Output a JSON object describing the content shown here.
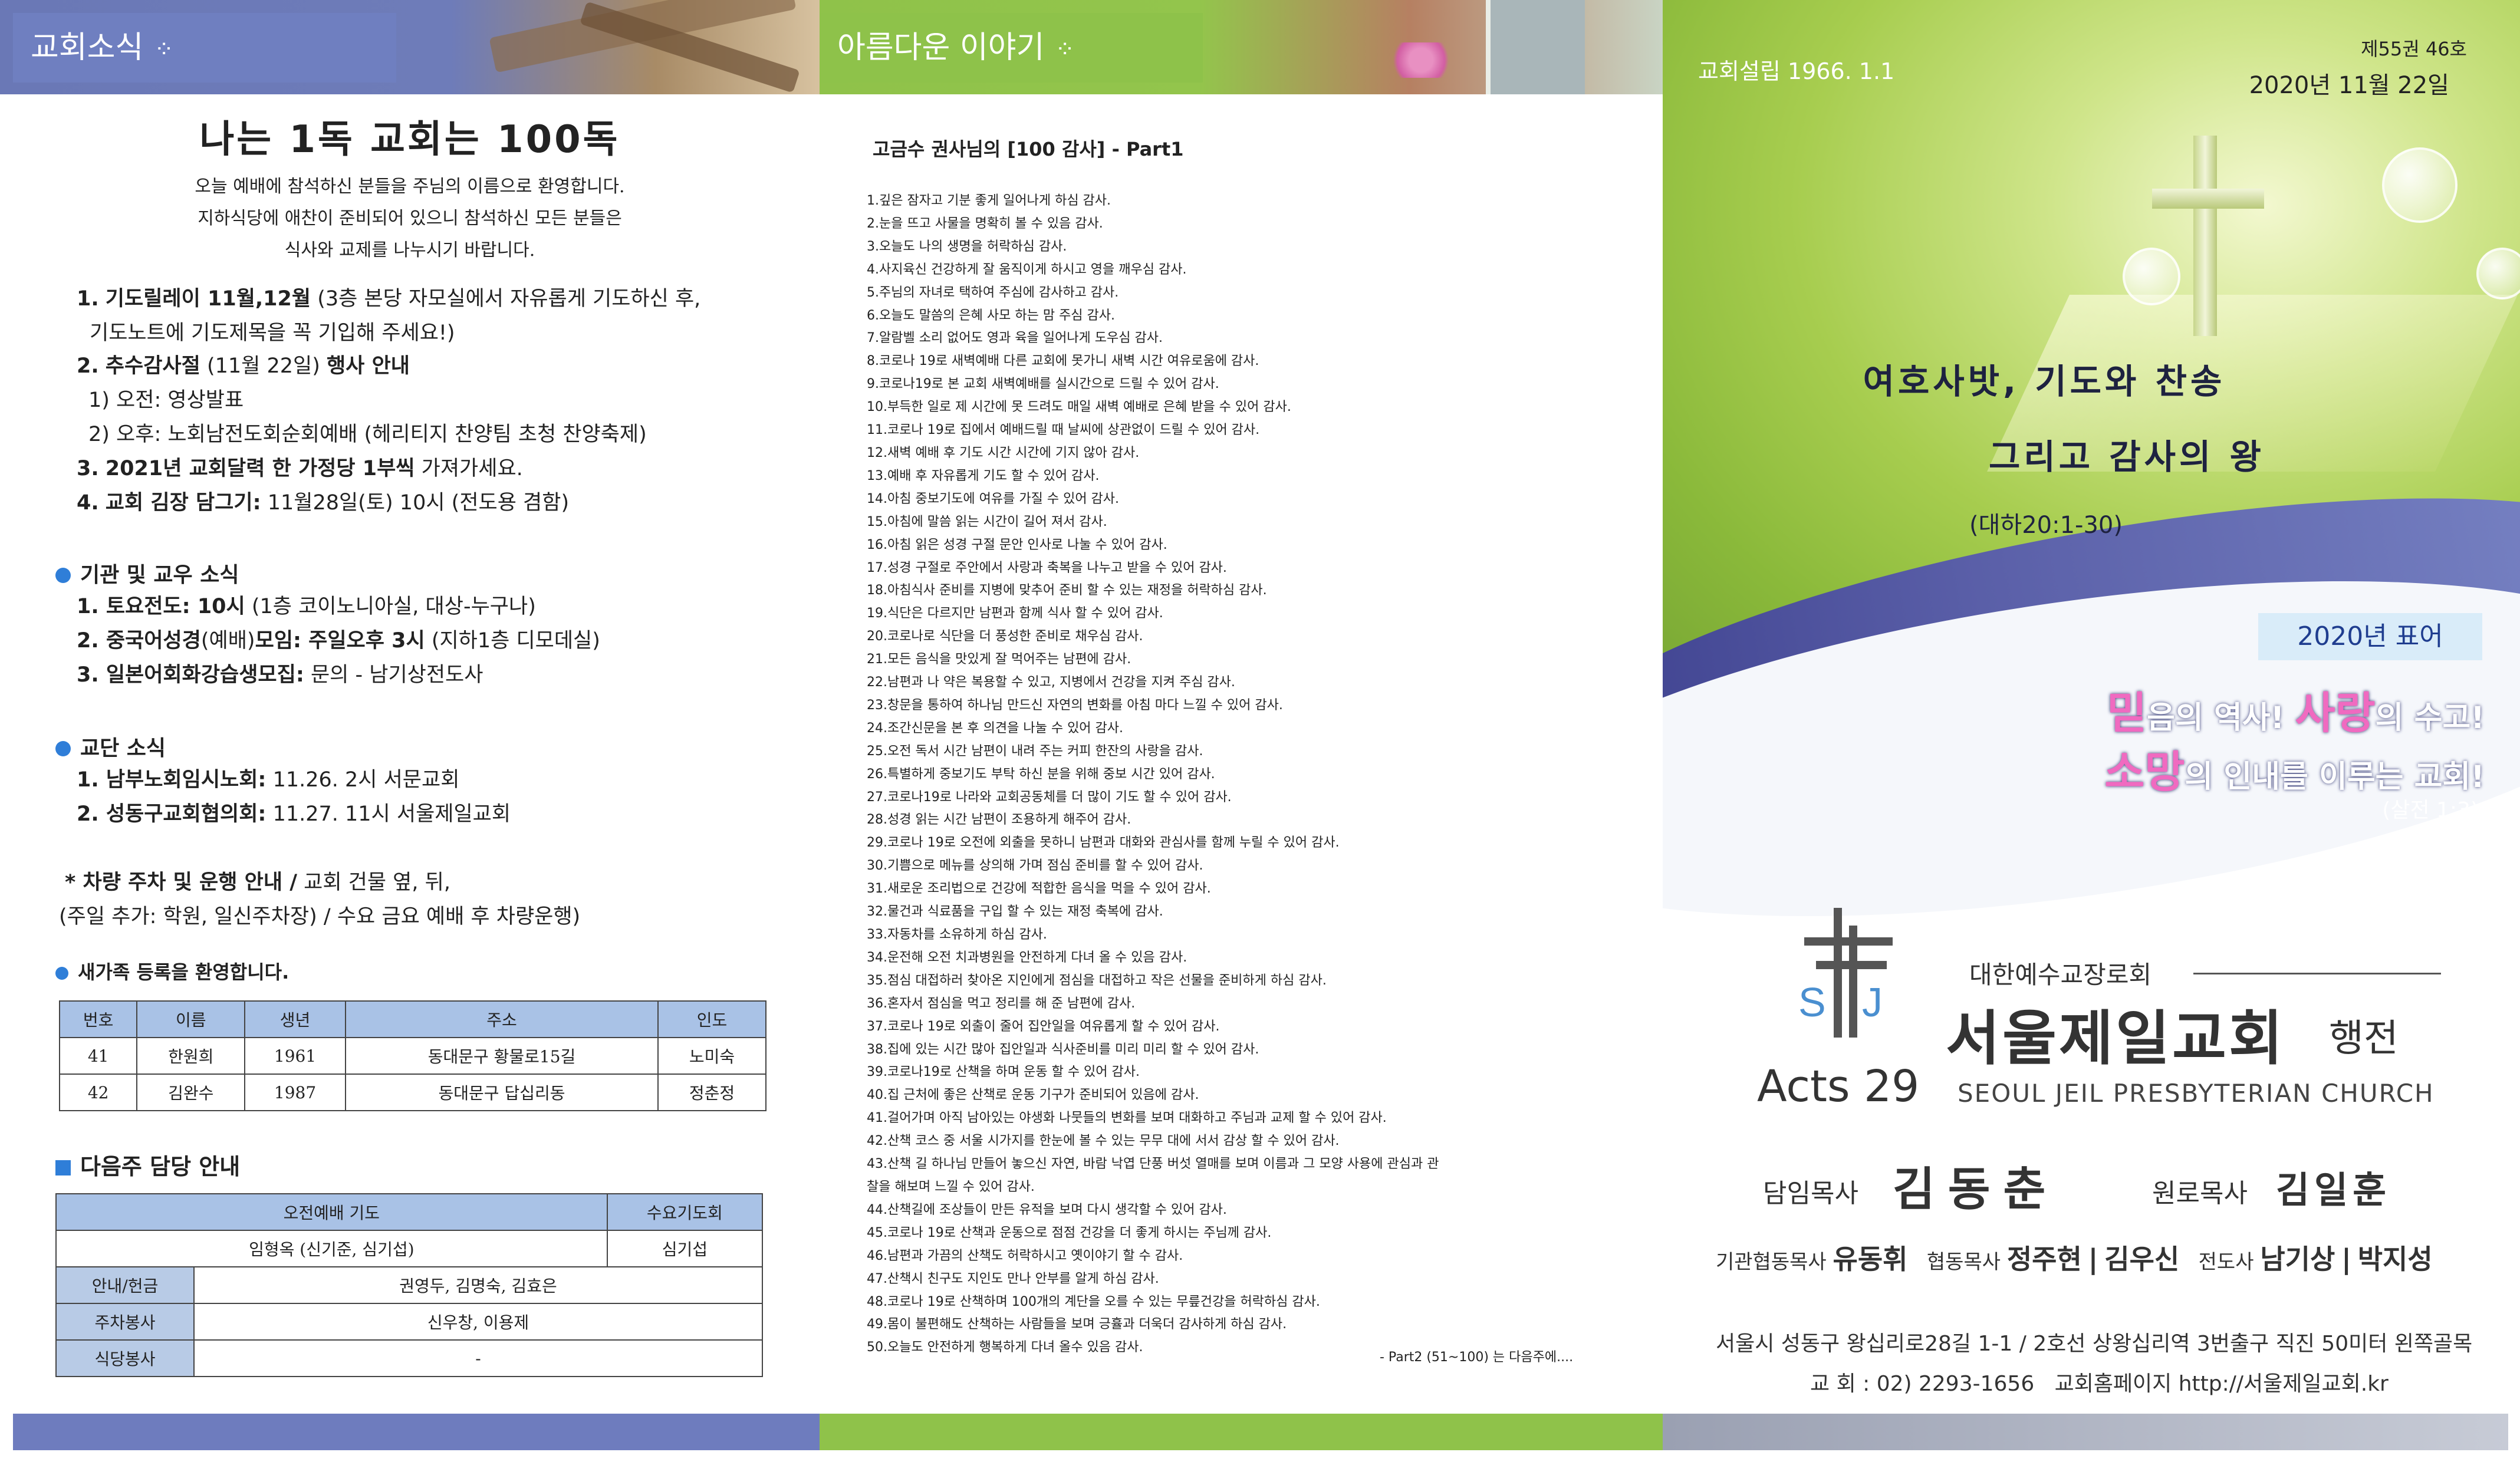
{
  "panel1": {
    "tab": "교회소식",
    "title": "나는 1독 교회는 100독",
    "welcome": [
      "오늘 예배에 참석하신 분들을 주님의 이름으로 환영합니다.",
      "지하식당에 애찬이 준비되어 있으니 참석하신 모든 분들은",
      "식사와 교제를 나누시기 바랍니다."
    ],
    "news": [
      {
        "num": "1.",
        "head": "기도릴레이 11월,12월",
        "rest": " (3층 본당 자모실에서 자유롭게 기도하신 후,"
      },
      {
        "num": "",
        "head": "",
        "rest": "기도노트에 기도제목을 꼭 기입해 주세요!)"
      },
      {
        "num": "2.",
        "head": "추수감사절",
        "rest": " (11월 22일) ",
        "tail": "행사 안내"
      },
      {
        "num": "",
        "head": "",
        "rest": "1) 오전: 영상발표"
      },
      {
        "num": "",
        "head": "",
        "rest": "2) 오후: 노회남전도회순회예배 (헤리티지 찬양팀 초청 찬양축제)"
      },
      {
        "num": "3.",
        "head": "2021년 교회달력 한 가정당 1부씩",
        "rest": " 가져가세요."
      },
      {
        "num": "4.",
        "head": "교회 김장 담그기:",
        "rest": " 11월28일(토) 10시 (전도용 겸함)"
      }
    ],
    "sec1": "기관 및 교우 소식",
    "sec1_items": [
      {
        "head": "1. 토요전도: 10시",
        "rest": " (1층 코이노니아실, 대상-누구나)"
      },
      {
        "head": "2. 중국어성경",
        "rest": "(예배)",
        "tail": "모임: 주일오후 3시",
        "rest2": " (지하1층 디모데실)"
      },
      {
        "head": "3. 일본어회화강습생모집:",
        "rest": " 문의 - 남기상전도사"
      }
    ],
    "sec2": "교단 소식",
    "sec2_items": [
      {
        "head": "1. 남부노회임시노회:",
        "rest": " 11.26. 2시 서문교회"
      },
      {
        "head": "2. 성동구교회협의회:",
        "rest": " 11.27. 11시 서울제일교회"
      }
    ],
    "parking": [
      "* 차량 주차 및 운행 안내 /",
      " 교회 건물 옆, 뒤,",
      "(주일 추가: 학원, 일신주차장) / 수요 금요 예배 후 차량운행)"
    ],
    "new_family": {
      "title": "새가족 등록을 환영합니다.",
      "headers": [
        "번호",
        "이름",
        "생년",
        "주소",
        "인도"
      ],
      "rows": [
        [
          "41",
          "한원희",
          "1961",
          "동대문구 황물로15길",
          "노미숙"
        ],
        [
          "42",
          "김완수",
          "1987",
          "동대문구 답십리동",
          "정춘정"
        ]
      ]
    },
    "duty": {
      "title": "다음주 담당 안내",
      "headers": [
        "오전예배 기도",
        "수요기도회"
      ],
      "row1": [
        "임형옥 (신기준, 심기섭)",
        "심기섭"
      ],
      "rows": [
        [
          "안내/헌금",
          "권영두, 김명숙, 김효은"
        ],
        [
          "주차봉사",
          "신우창, 이용제"
        ],
        [
          "식당봉사",
          "-"
        ]
      ]
    }
  },
  "panel2": {
    "tab": "아름다운 이야기",
    "title": "고금수 권사님의 [100 감사] - Part1",
    "lines": [
      "1.깊은 잠자고 기분 좋게 일어나게 하심 감사.",
      "2.눈을 뜨고 사물을 명확히 볼 수 있음 감사.",
      "3.오늘도 나의 생명을 허락하심 감사.",
      "4.사지육신 건강하게 잘 움직이게 하시고 영을 깨우심 감사.",
      "5.주님의 자녀로 택하여 주심에 감사하고 감사.",
      "6.오늘도 말씀의 은혜 사모 하는 맘 주심 감사.",
      "7.알람벨 소리 없어도 영과 육을 일어나게 도우심 감사.",
      "8.코로나 19로 새벽예배 다른 교회에 못가니 새벽 시간 여유로움에 감사.",
      "9.코로나19로 본 교회 새벽예배를 실시간으로 드릴 수 있어 감사.",
      "10.부득한 일로 제 시간에 못 드려도 매일 새벽 예배로 은혜 받을 수 있어 감사.",
      "11.코로나 19로 집에서 예배드릴 때 날씨에 상관없이 드릴 수 있어 감사.",
      "12.새벽 예배 후 기도 시간 시간에    기지 않아 감사.",
      "13.예배 후 자유롭게 기도 할 수 있어 감사.",
      "14.아침 중보기도에 여유를 가질 수 있어 감사.",
      "15.아침에 말씀 읽는 시간이 길어 져서 감사.",
      "16.아침 읽은 성경 구절 문안 인사로 나눌 수 있어 감사.",
      "17.성경 구절로 주안에서 사랑과 축복을 나누고 받을 수 있어 감사.",
      "18.아침식사 준비를 지병에 맞추어 준비 할 수 있는 재정을 허락하심 감사.",
      "19.식단은 다르지만 남편과 함께 식사 할 수 있어 감사.",
      "20.코로나로 식단을 더 풍성한 준비로 채우심 감사.",
      "21.모든 음식을 맛있게 잘 먹어주는 남편에 감사.",
      "22.남편과 나 약은 복용할 수 있고, 지병에서 건강을 지켜 주심 감사.",
      "23.창문을 통하여 하나님 만드신 자연의 변화를 아침 마다 느낄 수 있어 감사.",
      "24.조간신문을 본 후 의견을 나눌 수 있어 감사.",
      "25.오전 독서 시간 남편이 내려 주는 커피 한잔의 사랑을 감사.",
      "26.특별하게 중보기도 부탁 하신 분을 위해 중보 시간 있어 감사.",
      "27.코로나19로 나라와 교회공동체를 더 많이 기도 할 수 있어 감사.",
      "28.성경 읽는 시간 남편이 조용하게 해주어 감사.",
      "29.코로나 19로 오전에 외출을 못하니 남편과 대화와 관심사를 함께 누릴 수 있어 감사.",
      "30.기쁨으로 메뉴를 상의해 가며 점심 준비를 할 수 있어 감사.",
      "31.새로운 조리법으로 건강에 적합한 음식을 먹을 수 있어 감사.",
      "32.물건과 식료품을 구입 할 수 있는 재정 축복에 감사.",
      "33.자동차를 소유하게 하심 감사.",
      "34.운전해 오전 치과병원을 안전하게 다녀 올 수 있음 감사.",
      "35.점심 대접하러 찾아온 지인에게 점심을 대접하고 작은 선물을 준비하게 하심 감사.",
      "36.혼자서 점심을 먹고 정리를 해 준 남편에 감사.",
      "37.코로나 19로 외출이 줄어 집안일을 여유롭게 할 수 있어 감사.",
      "38.집에 있는 시간 많아 집안일과 식사준비를 미리 미리 할 수 있어 감사.",
      "39.코로나19로 산책을 하며 운동 할 수 있어 감사.",
      "40.집 근처에 좋은 산책로 운동 기구가 준비되어 있음에 감사.",
      "41.걸어가며 아직 남아있는 야생화 나뭇들의 변화를 보며 대화하고 주님과 교제 할 수 있어 감사.",
      "42.산책 코스 중 서울 시가지를 한눈에 볼 수 있는 무무 대에 서서 감상 할 수 있어 감사.",
      "43.산책 길 하나님 만들어 놓으신 자연, 바람 낙엽 단풍 버섯 열매를 보며 이름과 그 모양 사용에 관심과 관",
      "찰을 해보며 느낄 수 있어 감사.",
      "44.산책길에 조상들이 만든 유적을 보며 다시 생각할 수 있어 감사.",
      "45.코로나 19로 산책과 운동으로 점점 건강을 더 좋게 하시는 주님께 감사.",
      "46.남편과 가끔의 산책도 허락하시고 옛이야기 할 수 감사.",
      "47.산책시 친구도 지인도 만나 안부를 알게 하심 감사.",
      "48.코로나 19로 산책하며 100개의 계단을 오를 수 있는 무릎건강을 허락하심 감사.",
      "49.몸이 불편해도 산책하는 사람들을 보며 긍휼과 더욱더 감사하게 하심 감사.",
      "50.오늘도 안전하게 행복하게 다녀 올수 있음 감사."
    ],
    "continued": "- Part2 (51~100) 는 다음주에...."
  },
  "panel3": {
    "established": "교회설립 1966. 1.1",
    "volume": "제55권 46호",
    "date": "2020년 11월 22일",
    "theme1": "여호사밧, 기도와 찬송",
    "theme2": "그리고 감사의 왕",
    "verse": "(대하20:1-30)",
    "motto_tag": "2020년 표어",
    "motto1": {
      "a": "믿",
      "b": "음의 역사! ",
      "c": "사",
      "d": "랑",
      "e": "의 수고!"
    },
    "motto2": {
      "a": "소",
      "b": "망",
      "c": "의 인내를 이루는 교회!"
    },
    "motto_ref": "(살전 1:3)",
    "logo_s": "S",
    "logo_j": "J",
    "denomination": "대한예수교장로회",
    "church": "서울제일교회",
    "bulletin": "행전",
    "acts": "Acts 29",
    "english": "SEOUL JEIL PRESBYTERIAN CHURCH",
    "senior_label": "담임목사",
    "senior_name": "김동춘",
    "emeritus_label": "원로목사",
    "emeritus_name": "김일훈",
    "staff": {
      "l1": "기관협동목사",
      "n1": "유동휘",
      "l2": "협동목사",
      "n2": "정주현",
      "n3": "김우신",
      "l3": "전도사",
      "n4": "남기상",
      "n5": "박지성"
    },
    "address": "서울시 성동구 왕십리로28길 1-1 / 2호선 상왕십리역 3번출구 직진 50미터 왼쪽골목",
    "tel": "교 회 : 02) 2293-1656",
    "homepage": "교회홈페이지  http://서울제일교회.kr"
  },
  "colors": {
    "blue": "#6f7fc0",
    "green": "#8ec24a",
    "accent_pink": "#f06ac0"
  }
}
